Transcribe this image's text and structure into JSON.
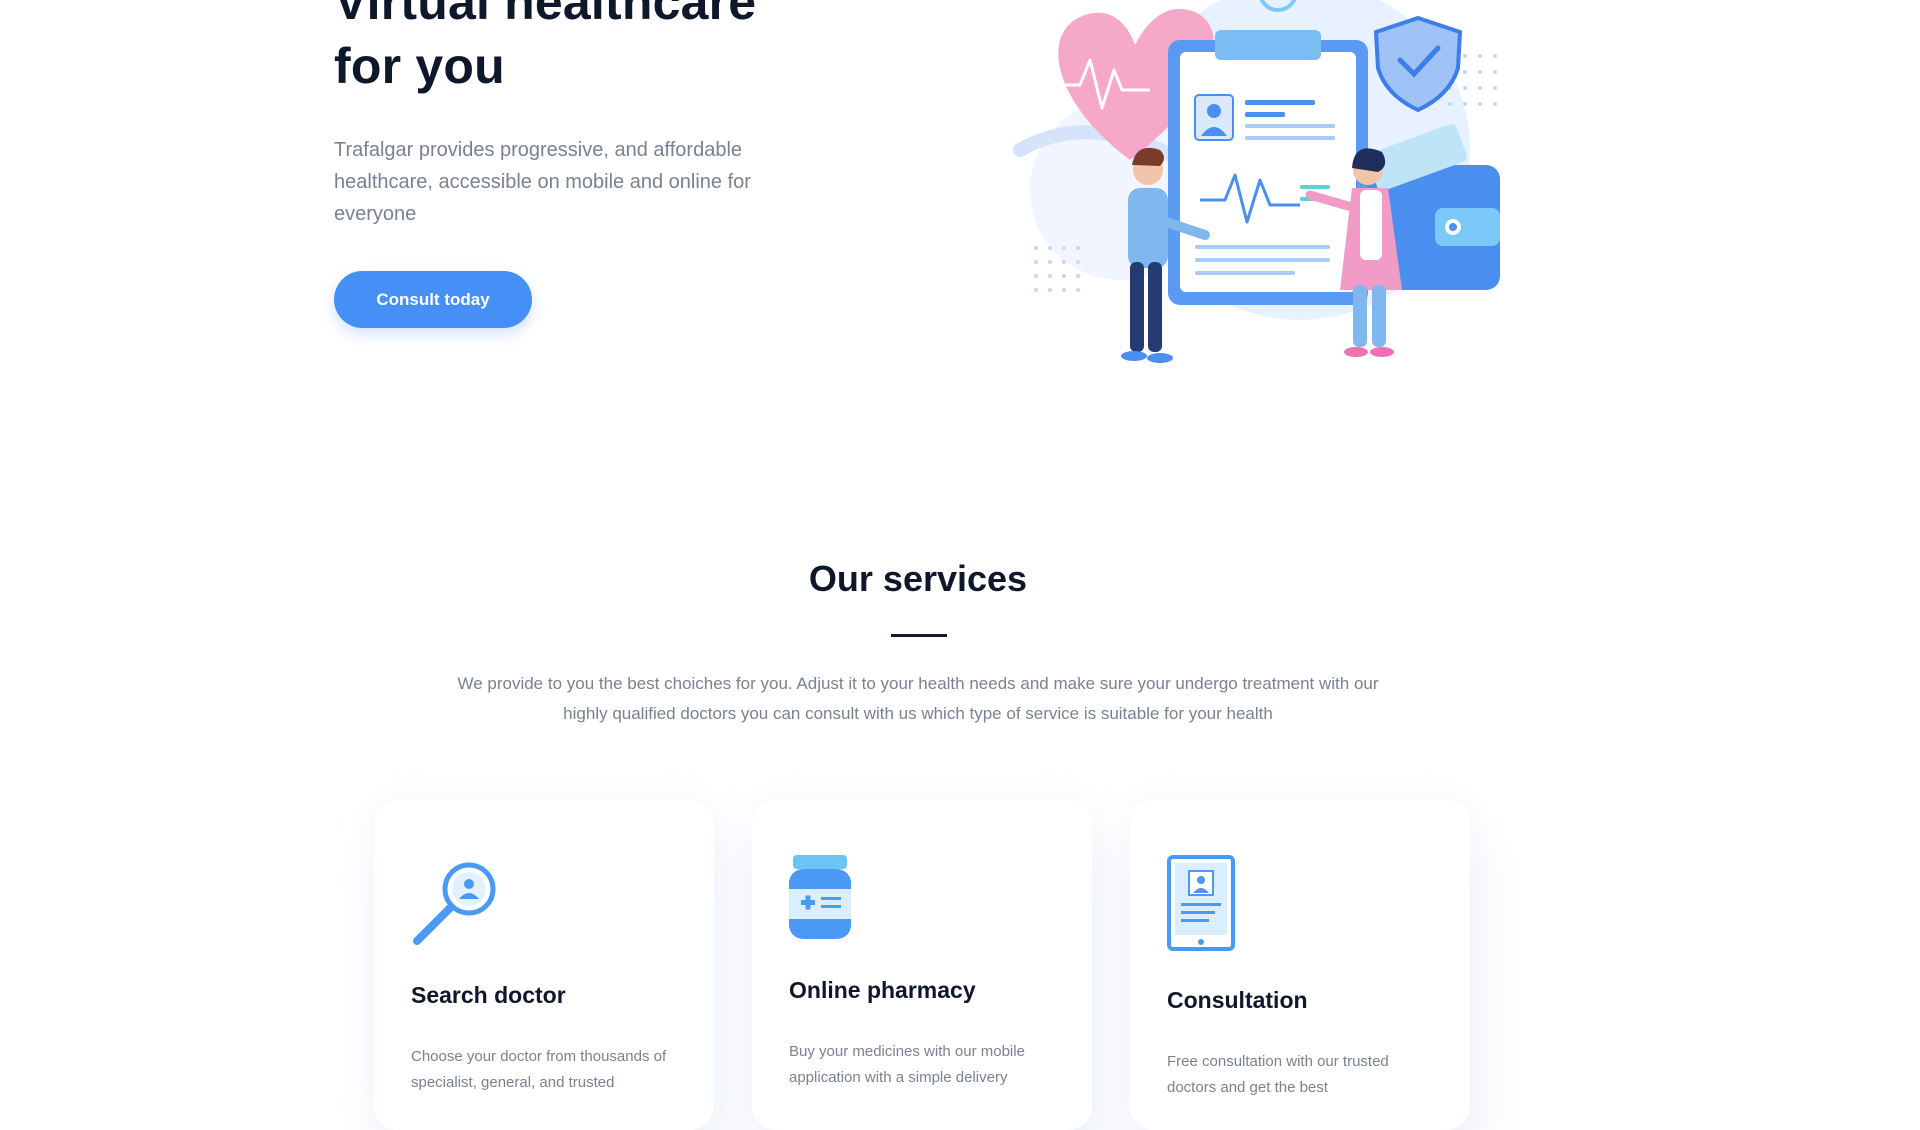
{
  "hero": {
    "title_line1": "Virtual healthcare",
    "title_line2": "for you",
    "description": "Trafalgar provides progressive, and affordable healthcare, accessible on mobile and online for everyone",
    "cta_label": "Consult today"
  },
  "services": {
    "title": "Our services",
    "description": "We provide to you the best choiches for you. Adjust it to your health needs and make sure your undergo treatment with our highly qualified doctors you can consult with us which type of service is suitable for your health",
    "cards": [
      {
        "icon": "search-doctor-icon",
        "title": "Search doctor",
        "description": "Choose your doctor from thousands of specialist, general, and trusted"
      },
      {
        "icon": "pharmacy-icon",
        "title": "Online pharmacy",
        "description": "Buy your medicines with our mobile application with a simple delivery"
      },
      {
        "icon": "consultation-icon",
        "title": "Consultation",
        "description": "Free consultation with our trusted doctors and get the best"
      }
    ]
  },
  "colors": {
    "primary": "#458ff6",
    "heading": "#0f172a",
    "body_text": "#7b8190",
    "accent_pink": "#f7a1c4"
  }
}
